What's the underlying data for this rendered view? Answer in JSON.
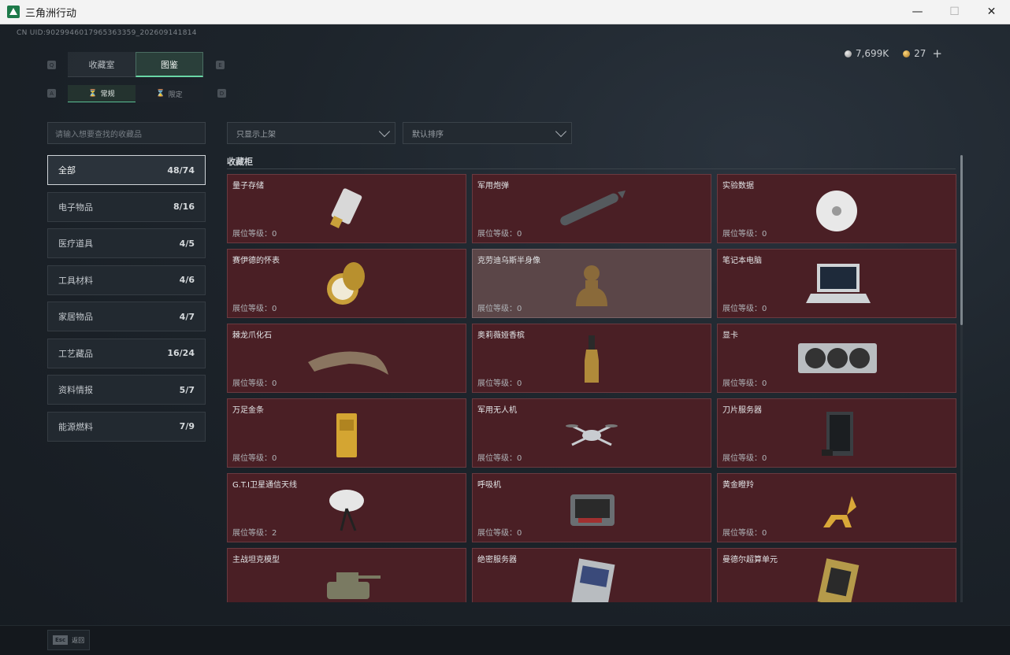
{
  "window": {
    "title": "三角洲行动",
    "minimize": "—",
    "maximize": "☐",
    "close": "✕"
  },
  "uid": "CN UID:9029946017965363359_202609141814",
  "currency": {
    "silver": "7,699K",
    "gold": "27",
    "add": "+"
  },
  "keys": {
    "q": "Q",
    "e": "E",
    "a": "A",
    "d": "D"
  },
  "main_tabs": [
    {
      "label": "收藏室",
      "active": false
    },
    {
      "label": "图鉴",
      "active": true
    }
  ],
  "sub_tabs": [
    {
      "label": "常规",
      "active": true
    },
    {
      "label": "限定",
      "active": false
    }
  ],
  "search": {
    "placeholder": "请输入想要查找的收藏品"
  },
  "filter": {
    "display": "只显示上架",
    "sort": "默认排序"
  },
  "categories": [
    {
      "label": "全部",
      "count": "48/74",
      "active": true
    },
    {
      "label": "电子物品",
      "count": "8/16"
    },
    {
      "label": "医疗道具",
      "count": "4/5"
    },
    {
      "label": "工具材料",
      "count": "4/6"
    },
    {
      "label": "家居物品",
      "count": "4/7"
    },
    {
      "label": "工艺藏品",
      "count": "16/24"
    },
    {
      "label": "资料情报",
      "count": "5/7"
    },
    {
      "label": "能源燃料",
      "count": "7/9"
    }
  ],
  "section_title": "收藏柜",
  "items": [
    {
      "name": "量子存储",
      "level": "展位等级：0",
      "icon": "usb-drive-icon",
      "color": "#d8d8d8"
    },
    {
      "name": "军用炮弹",
      "level": "展位等级：0",
      "icon": "missile-icon",
      "color": "#555a5e"
    },
    {
      "name": "实验数据",
      "level": "展位等级：0",
      "icon": "disc-icon",
      "color": "#e8e8e8"
    },
    {
      "name": "赛伊德的怀表",
      "level": "展位等级：0",
      "icon": "pocket-watch-icon",
      "color": "#c9a03a"
    },
    {
      "name": "克劳迪乌斯半身像",
      "level": "展位等级：0",
      "icon": "bust-icon",
      "color": "#8a6a3a",
      "highlight": true
    },
    {
      "name": "笔记本电脑",
      "level": "展位等级：0",
      "icon": "laptop-icon",
      "color": "#cfd3d6"
    },
    {
      "name": "棘龙爪化石",
      "level": "展位等级：0",
      "icon": "claw-fossil-icon",
      "color": "#8a7560"
    },
    {
      "name": "奥莉薇娅香槟",
      "level": "展位等级：0",
      "icon": "champagne-icon",
      "color": "#b08a3a"
    },
    {
      "name": "显卡",
      "level": "展位等级：0",
      "icon": "graphics-card-icon",
      "color": "#b9bdc0"
    },
    {
      "name": "万足金条",
      "level": "展位等级：0",
      "icon": "gold-bar-icon",
      "color": "#d4a532"
    },
    {
      "name": "军用无人机",
      "level": "展位等级：0",
      "icon": "drone-icon",
      "color": "#c8ccd0"
    },
    {
      "name": "刀片服务器",
      "level": "展位等级：0",
      "icon": "server-icon",
      "color": "#3a3e42"
    },
    {
      "name": "G.T.I卫星通信天线",
      "level": "展位等级：2",
      "icon": "satellite-dish-icon",
      "color": "#e6e6e6"
    },
    {
      "name": "呼吸机",
      "level": "展位等级：0",
      "icon": "ventilator-icon",
      "color": "#6a6e72"
    },
    {
      "name": "黄金瞪羚",
      "level": "展位等级：0",
      "icon": "gazelle-icon",
      "color": "#d9a838"
    },
    {
      "name": "主战坦克模型",
      "level": "",
      "icon": "tank-icon",
      "color": "#7a7a62"
    },
    {
      "name": "绝密服务器",
      "level": "",
      "icon": "server-board-icon",
      "color": "#b8bcc0"
    },
    {
      "name": "曼德尔超算单元",
      "level": "",
      "icon": "chip-icon",
      "color": "#b59a4a"
    }
  ],
  "footer": {
    "esc_key": "Esc",
    "esc_label": "返回"
  }
}
